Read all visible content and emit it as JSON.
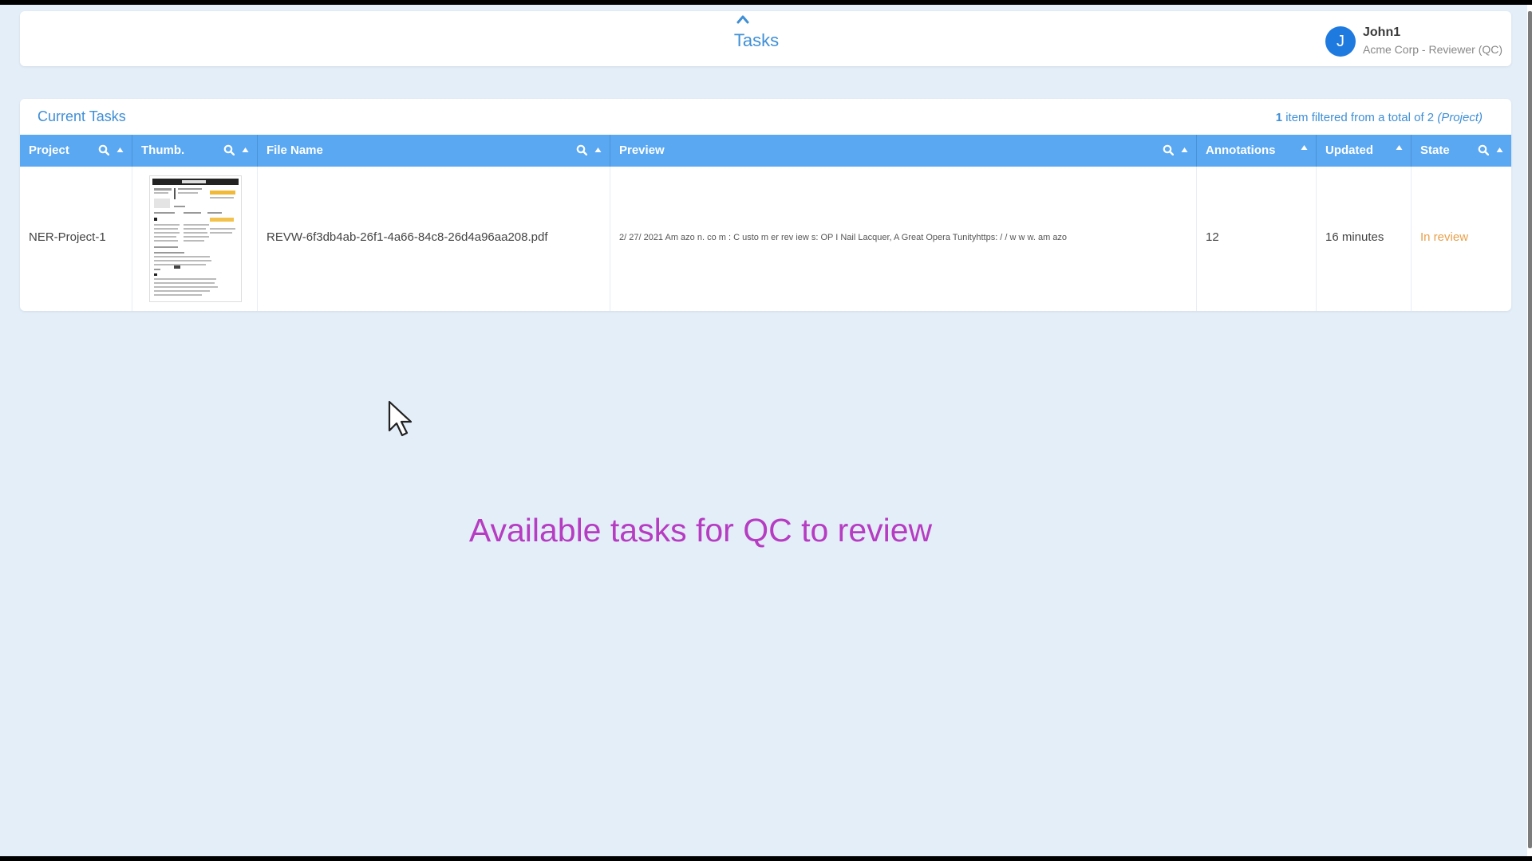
{
  "header": {
    "title": "Tasks",
    "user": {
      "initial": "J",
      "name": "John1",
      "role": "Acme Corp - Reviewer (QC)"
    }
  },
  "tasks_panel": {
    "title": "Current Tasks",
    "filter": {
      "count": "1",
      "text": "item filtered from a total of 2",
      "scope": "(Project)"
    },
    "columns": [
      {
        "label": "Project",
        "search": true,
        "sort": true
      },
      {
        "label": "Thumb.",
        "search": true,
        "sort": true
      },
      {
        "label": "File Name",
        "search": true,
        "sort": true
      },
      {
        "label": "Preview",
        "search": true,
        "sort": true
      },
      {
        "label": "Annotations",
        "search": false,
        "sort": true
      },
      {
        "label": "Updated",
        "search": false,
        "sort": true
      },
      {
        "label": "State",
        "search": true,
        "sort": true
      }
    ],
    "rows": [
      {
        "project": "NER-Project-1",
        "file_name": "REVW-6f3db4ab-26f1-4a66-84c8-26d4a96aa208.pdf",
        "preview": "2/ 27/ 2021 Am azo n. co m : C usto m er rev iew s: OP I Nail Lacquer, A Great Opera Tunityhttps: / / w w w. am azo",
        "annotations": "12",
        "updated": "16 minutes",
        "state": "In review"
      }
    ]
  },
  "caption": "Available tasks for QC to review",
  "colors": {
    "accent": "#3f8fd6",
    "header_bar": "#5aa8f2",
    "state_in_review": "#e8a04a",
    "caption": "#b63cc2",
    "avatar": "#1f7ae0"
  },
  "icons": {
    "search": "magnifier-icon",
    "sort": "sort-up-triangle-icon",
    "collapse": "chevron-up-icon",
    "cursor": "mouse-pointer-icon"
  }
}
